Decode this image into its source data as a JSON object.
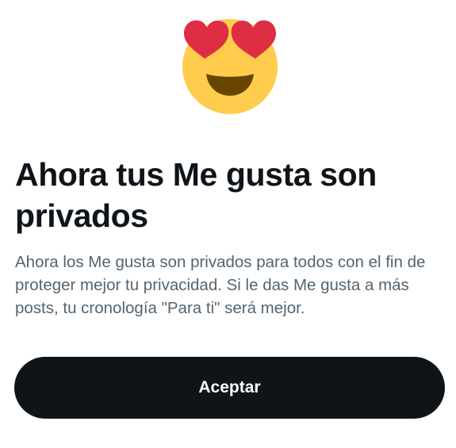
{
  "icon": {
    "name": "heart-eyes-emoji-icon",
    "face_color": "#FFCC4D",
    "heart_color": "#DD2E44",
    "mouth_color": "#664500"
  },
  "dialog": {
    "title": "Ahora tus Me gusta son privados",
    "body": "Ahora los Me gusta son privados para todos con el fin de proteger mejor tu privacidad. Si le das Me gusta a más posts, tu cronología \"Para ti\" será mejor.",
    "accept_label": "Aceptar"
  },
  "colors": {
    "title": "#0f1419",
    "body": "#536471",
    "button_bg": "#0f1419",
    "button_text": "#ffffff"
  }
}
